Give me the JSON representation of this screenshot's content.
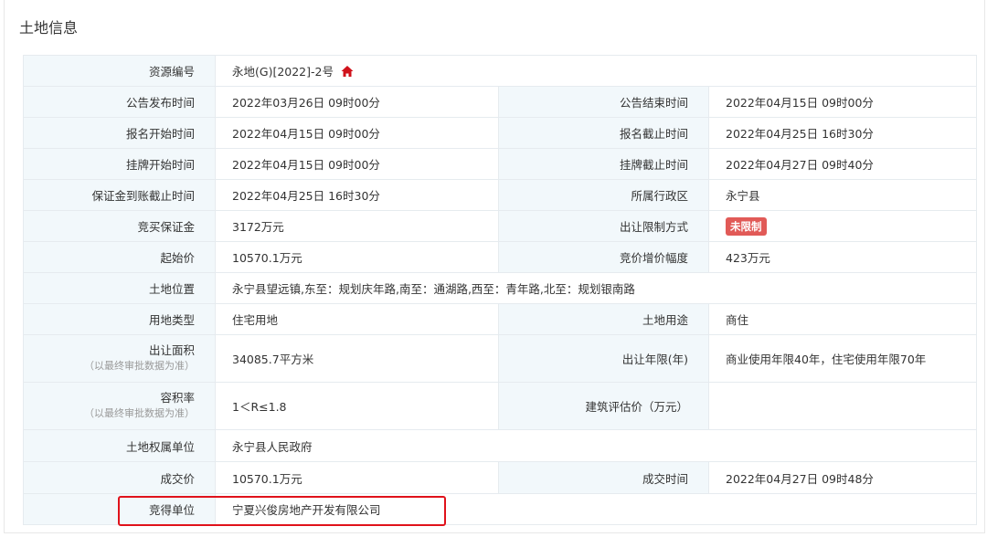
{
  "section": {
    "title": "土地信息"
  },
  "rows": {
    "r0": {
      "l1": "资源编号",
      "v1": "永地(G)[2022]-2号"
    },
    "r1": {
      "l1": "公告发布时间",
      "v1": "2022年03月26日 09时00分",
      "l2": "公告结束时间",
      "v2": "2022年04月15日 09时00分"
    },
    "r2": {
      "l1": "报名开始时间",
      "v1": "2022年04月15日 09时00分",
      "l2": "报名截止时间",
      "v2": "2022年04月25日 16时30分"
    },
    "r3": {
      "l1": "挂牌开始时间",
      "v1": "2022年04月15日 09时00分",
      "l2": "挂牌截止时间",
      "v2": "2022年04月27日 09时40分"
    },
    "r4": {
      "l1": "保证金到账截止时间",
      "v1": "2022年04月25日 16时30分",
      "l2": "所属行政区",
      "v2": "永宁县"
    },
    "r5": {
      "l1": "竞买保证金",
      "v1": "3172万元",
      "l2": "出让限制方式",
      "badge": "未限制"
    },
    "r6": {
      "l1": "起始价",
      "v1": "10570.1万元",
      "l2": "竞价增价幅度",
      "v2": "423万元"
    },
    "r7": {
      "l1": "土地位置",
      "v1": "永宁县望远镇,东至：规划庆年路,南至：通湖路,西至：青年路,北至：规划银南路"
    },
    "r8": {
      "l1": "用地类型",
      "v1": "住宅用地",
      "l2": "土地用途",
      "v2": "商住"
    },
    "r9": {
      "l1": "出让面积",
      "l1sub": "（以最终审批数据为准）",
      "v1": "34085.7平方米",
      "l2": "出让年限(年)",
      "v2": "商业使用年限40年，住宅使用年限70年"
    },
    "r10": {
      "l1": "容积率",
      "l1sub": "（以最终审批数据为准）",
      "v1": "1＜R≤1.8",
      "l2": "建筑评估价（万元）",
      "v2": ""
    },
    "r11": {
      "l1": "土地权属单位",
      "v1": "永宁县人民政府"
    },
    "r12": {
      "l1": "成交价",
      "v1": "10570.1万元",
      "l2": "成交时间",
      "v2": "2022年04月27日 09时48分"
    },
    "r13": {
      "l1": "竞得单位",
      "v1": "宁夏兴俊房地产开发有限公司"
    }
  },
  "colors": {
    "label_bg": "#f2f8fb",
    "badge": "#e15a57",
    "home_icon": "#d0121b",
    "highlight": "#e0121b"
  },
  "icons": {
    "resource_id": "home-icon"
  }
}
